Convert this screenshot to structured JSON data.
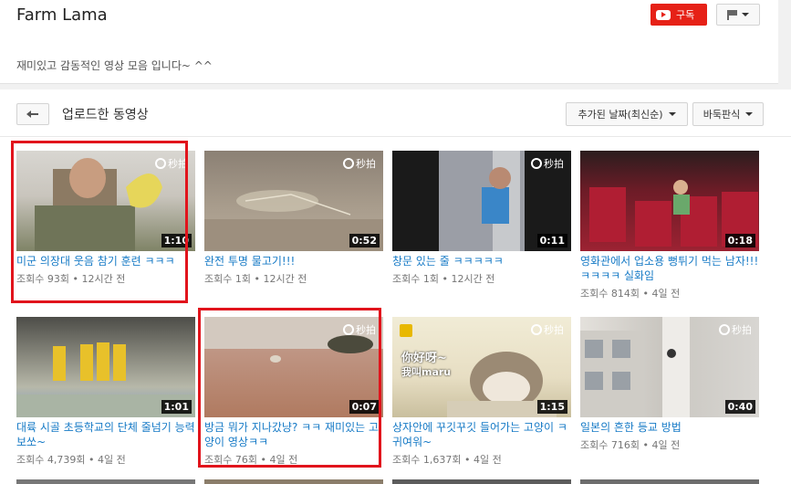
{
  "channel": {
    "title": "Farm Lama",
    "subscribe_label": "구독",
    "description": "재미있고 감동적인 영상 모음 입니다~ ^^"
  },
  "toolbar": {
    "section_title": "업로드한 동영상",
    "sort_label": "추가된 날짜(최신순)",
    "view_label": "바둑판식"
  },
  "videos": [
    {
      "title": "미군 의장대 웃음 참기 훈련 ㅋㅋㅋ",
      "views": "조회수 93회",
      "age": "12시간 전",
      "duration": "1:10",
      "watermark": "秒拍"
    },
    {
      "title": "완전 투명 물고기!!!",
      "views": "조회수 1회",
      "age": "12시간 전",
      "duration": "0:52",
      "watermark": "秒拍"
    },
    {
      "title": "창문 있는 줄 ㅋㅋㅋㅋㅋ",
      "views": "조회수 1회",
      "age": "12시간 전",
      "duration": "0:11",
      "watermark": "秒拍"
    },
    {
      "title": "영화관에서 업소용 뻥튀기 먹는 남자!!! ㅋㅋㅋㅋ 실화임",
      "views": "조회수 814회",
      "age": "4일 전",
      "duration": "0:18",
      "watermark": ""
    },
    {
      "title": "대륙 시골 초등학교의 단체 줄넘기 능력 보쏘~",
      "views": "조회수 4,739회",
      "age": "4일 전",
      "duration": "1:01",
      "watermark": ""
    },
    {
      "title": "방금 뭐가 지나갔냥? ㅋㅋ 재미있는 고양이 영상ㅋㅋ",
      "views": "조회수 76회",
      "age": "4일 전",
      "duration": "0:07",
      "watermark": "秒拍"
    },
    {
      "title": "상자안에 꾸깃꾸깃 들어가는 고양이 ㅋ 귀여워~",
      "views": "조회수 1,637회",
      "age": "4일 전",
      "duration": "1:15",
      "watermark": "秒拍",
      "caption1": "你好呀~",
      "caption2": "我叫maru"
    },
    {
      "title": "일본의 흔한 등교 방법",
      "views": "조회수 716회",
      "age": "4일 전",
      "duration": "0:40",
      "watermark": "秒拍"
    }
  ],
  "colors": {
    "accent_red": "#e62117",
    "link_blue": "#167ac6",
    "highlight_red": "#e1141c"
  }
}
